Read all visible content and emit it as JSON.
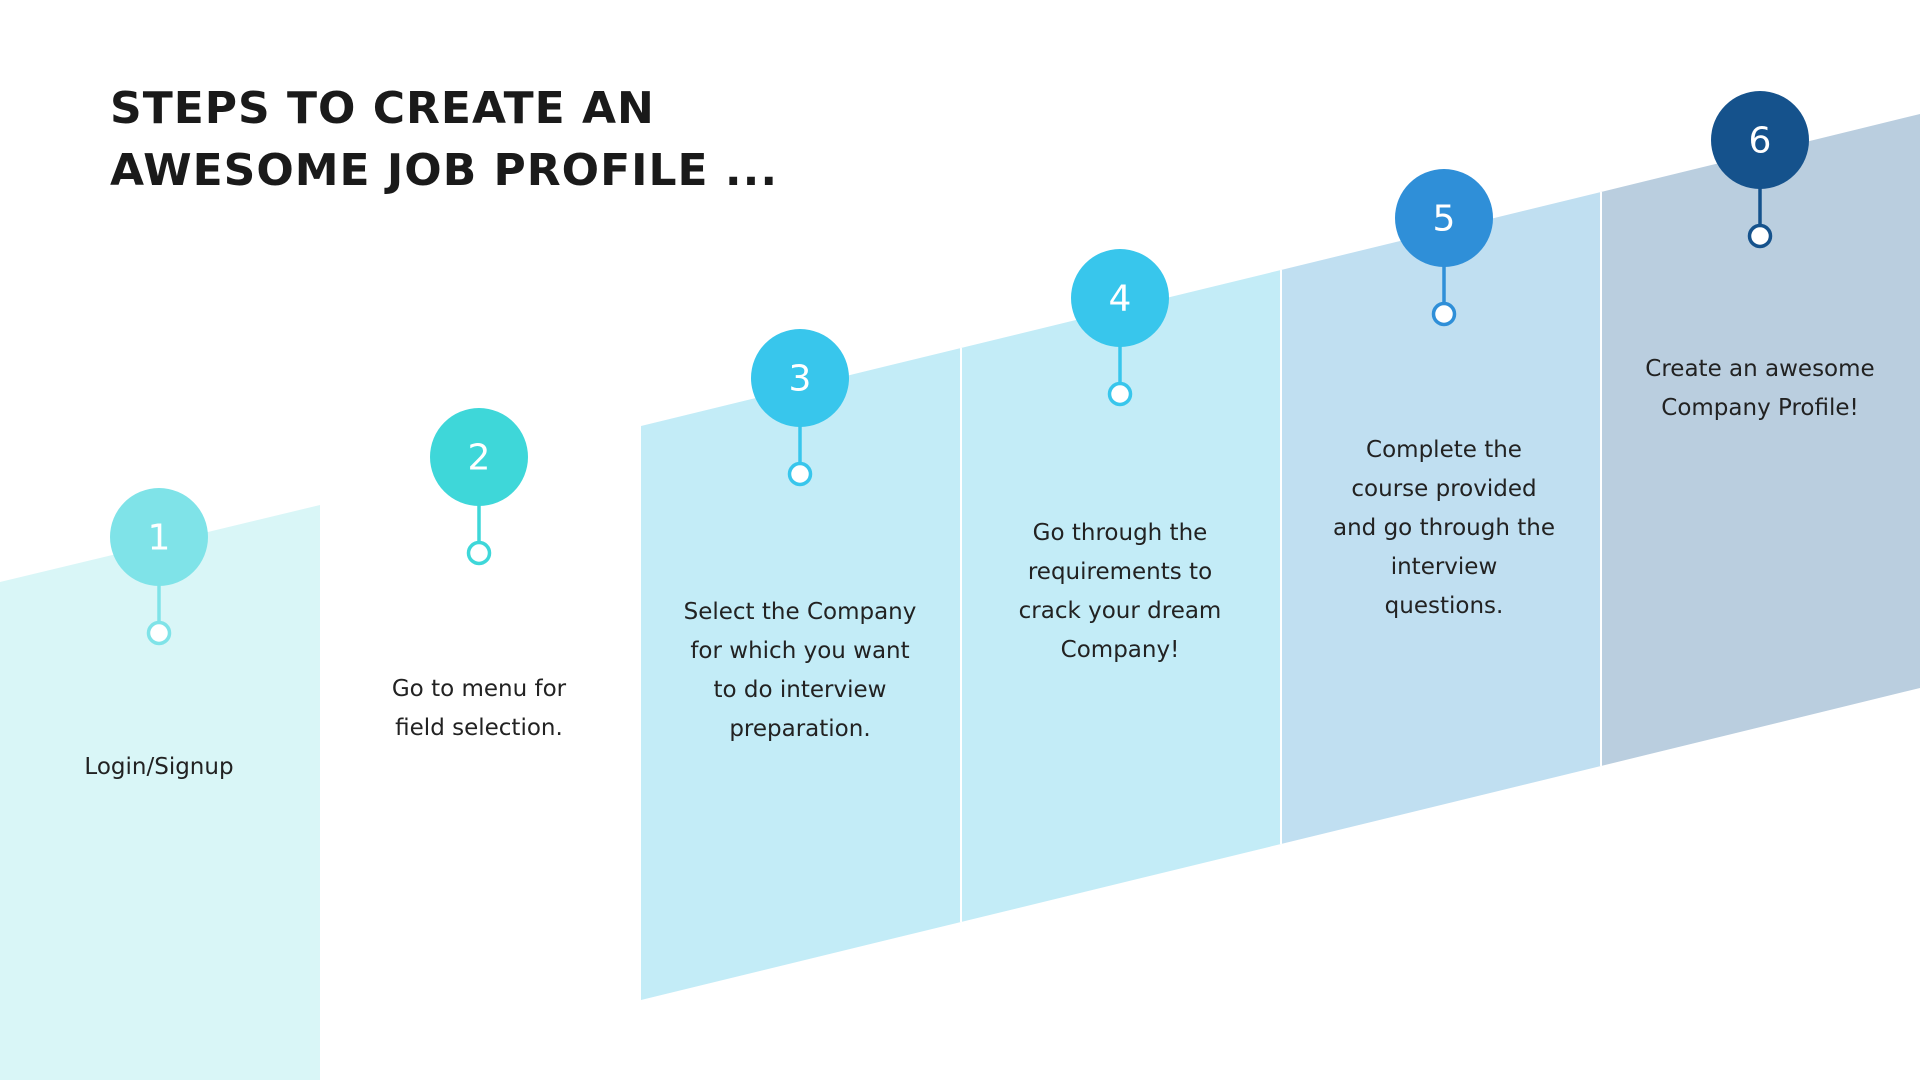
{
  "title": {
    "line1": "STEPS TO CREATE AN",
    "line2": "AWESOME JOB PROFILE ..."
  },
  "colors": {
    "band_1": "#d9f6f7",
    "band_3": "#c3ecf7",
    "band_4": "#c3ecf7",
    "band_5": "#c0dff1",
    "band_6": "#bacedf",
    "marker_1": "#7fe3e8",
    "marker_2": "#3ed7d9",
    "marker_3": "#38c6ec",
    "marker_4": "#38c6ec",
    "marker_5": "#2f8fd8",
    "marker_6": "#15528c"
  },
  "steps": [
    {
      "number": "1",
      "text": "Login/Signup"
    },
    {
      "number": "2",
      "text": "Go to menu  for\nfield selection."
    },
    {
      "number": "3",
      "text": "Select the Company\nfor which you want\nto do interview\npreparation."
    },
    {
      "number": "4",
      "text": "Go through the\nrequirements to\ncrack your dream\nCompany!"
    },
    {
      "number": "5",
      "text": "Complete the\ncourse provided\nand go through the\ninterview\nquestions."
    },
    {
      "number": "6",
      "text": "Create an awesome\nCompany Profile!"
    }
  ]
}
